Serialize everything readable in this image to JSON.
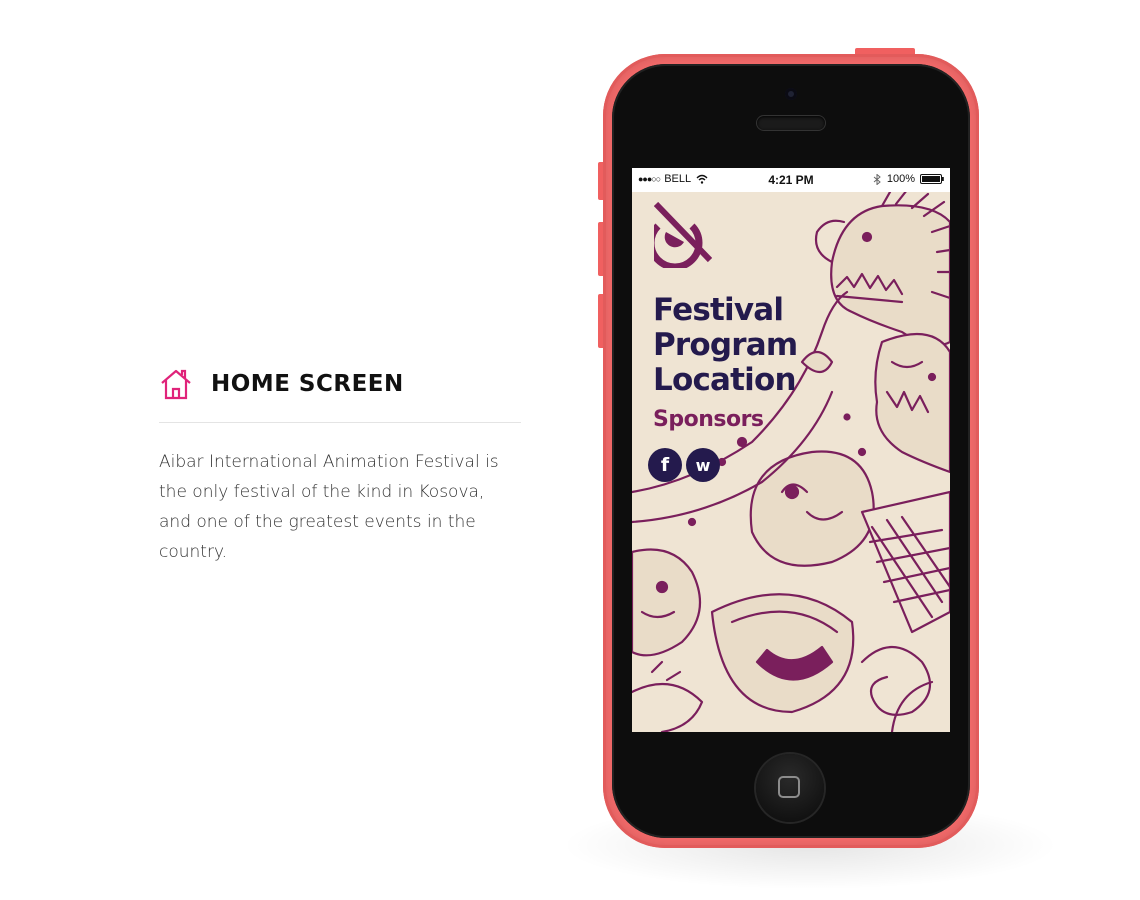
{
  "info": {
    "title": "HOME SCREEN",
    "icon": "house-icon",
    "description": "Aibar International Animation Festival is the only festival of the kind in Kosova, and one of the greatest events in the country.",
    "accent_color": "#e0237a"
  },
  "phone": {
    "color": "#f36a6a",
    "status_bar": {
      "carrier": "BELL",
      "signal": "●●●○○",
      "time": "4:21 PM",
      "battery": "100%"
    },
    "app": {
      "menu": [
        "Festival",
        "Program",
        "Location"
      ],
      "sponsors": "Sponsors",
      "social": [
        {
          "name": "facebook",
          "label": "f"
        },
        {
          "name": "web",
          "label": "w"
        }
      ],
      "colors": {
        "primary": "#241a4d",
        "secondary": "#7a1f5c",
        "background": "#efe4d3"
      }
    }
  }
}
